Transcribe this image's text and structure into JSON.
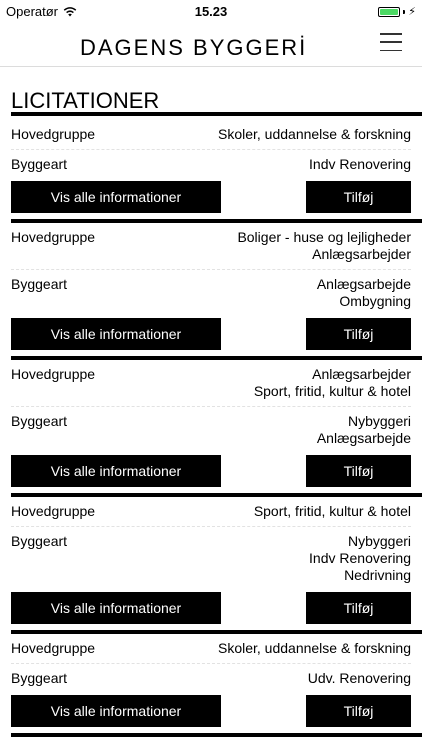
{
  "status": {
    "carrier": "Operatør",
    "time": "15.23"
  },
  "nav": {
    "logo": "DAGENS BYGGERİ"
  },
  "page": {
    "title": "LICITATIONER"
  },
  "labels": {
    "group": "Hovedgruppe",
    "type": "Byggeart",
    "info_button": "Vis alle informationer",
    "add_button": "Tilføj"
  },
  "entries": [
    {
      "group": [
        "Skoler, uddannelse & forskning"
      ],
      "type": [
        "Indv Renovering"
      ]
    },
    {
      "group": [
        "Boliger - huse og lejligheder",
        "Anlægsarbejder"
      ],
      "type": [
        "Anlægsarbejde",
        "Ombygning"
      ]
    },
    {
      "group": [
        "Anlægsarbejder",
        "Sport, fritid, kultur & hotel"
      ],
      "type": [
        "Nybyggeri",
        "Anlægsarbejde"
      ]
    },
    {
      "group": [
        "Sport, fritid, kultur & hotel"
      ],
      "type": [
        "Nybyggeri",
        "Indv Renovering",
        "Nedrivning"
      ]
    },
    {
      "group": [
        "Skoler, uddannelse & forskning"
      ],
      "type": [
        "Udv. Renovering"
      ]
    }
  ]
}
